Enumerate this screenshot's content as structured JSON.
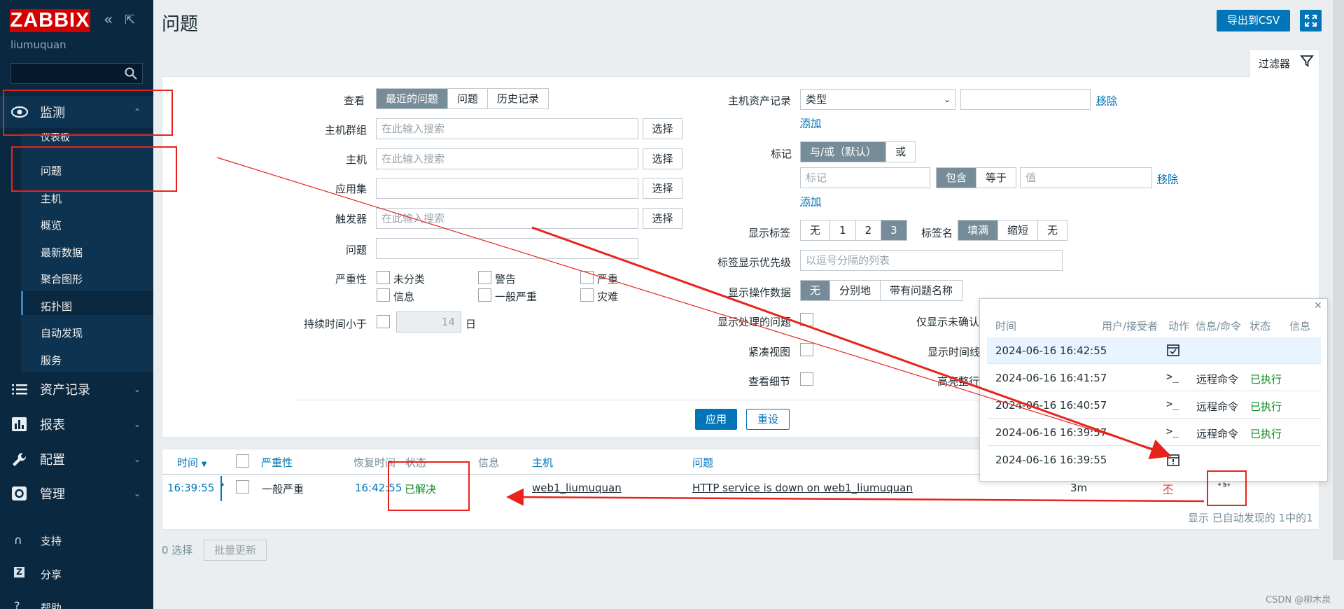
{
  "sidebar": {
    "logo": "ZABBIX",
    "username": "liumuquan",
    "search_placeholder": "",
    "sections": [
      {
        "label": "监测",
        "icon": "eye-icon"
      },
      {
        "label": "资产记录",
        "icon": "list-icon"
      },
      {
        "label": "报表",
        "icon": "bar-chart-icon"
      },
      {
        "label": "配置",
        "icon": "wrench-icon"
      },
      {
        "label": "管理",
        "icon": "gear-icon"
      }
    ],
    "monitoring_items": [
      "仪表板",
      "问题",
      "主机",
      "概览",
      "最新数据",
      "聚合图形",
      "拓扑图",
      "自动发现",
      "服务"
    ],
    "bottom": [
      {
        "label": "支持",
        "icon": "headset-icon"
      },
      {
        "label": "分享",
        "icon": "share-icon"
      },
      {
        "label": "帮助",
        "icon": "help-icon"
      }
    ]
  },
  "header": {
    "title": "问题",
    "export_label": "导出到CSV"
  },
  "filter": {
    "tab_label": "过滤器",
    "show_label": "查看",
    "show_options": [
      "最近的问题",
      "问题",
      "历史记录"
    ],
    "hostgroup_label": "主机群组",
    "host_label": "主机",
    "app_label": "应用集",
    "trigger_label": "触发器",
    "problem_label": "问题",
    "search_placeholder": "在此输入搜索",
    "select_label": "选择",
    "severity_label": "严重性",
    "severities": [
      "未分类",
      "警告",
      "严重",
      "信息",
      "一般严重",
      "灾难"
    ],
    "duration_label": "持续时间小于",
    "duration_value": "14",
    "duration_unit": "日",
    "inventory_label": "主机资产记录",
    "inventory_type": "类型",
    "remove_label": "移除",
    "add_label": "添加",
    "tags_label": "标记",
    "tags_eval_options": [
      "与/或（默认）",
      "或"
    ],
    "tag_placeholder": "标记",
    "tag_ops": [
      "包含",
      "等于"
    ],
    "value_placeholder": "值",
    "show_tags_label": "显示标签",
    "show_tags_options": [
      "无",
      "1",
      "2",
      "3"
    ],
    "tag_name_label": "标签名",
    "tag_name_options": [
      "填满",
      "缩短",
      "无"
    ],
    "tag_priority_label": "标签显示优先级",
    "tag_priority_placeholder": "以逗号分隔的列表",
    "op_data_label": "显示操作数据",
    "op_data_options": [
      "无",
      "分别地",
      "带有问题名称"
    ],
    "suppressed_label": "显示处理的问题",
    "unack_label": "仅显示未确认",
    "compact_label": "紧凑视图",
    "timeline_label": "显示时间线",
    "details_label": "查看细节",
    "highlight_label": "高亮整行",
    "apply_label": "应用",
    "reset_label": "重设"
  },
  "table": {
    "headers": [
      "时间",
      "严重性",
      "恢复时间",
      "状态",
      "信息",
      "主机",
      "问题"
    ],
    "row": {
      "time": "16:39:55",
      "severity": "一般严重",
      "recovery": "16:42:55",
      "status": "已解决",
      "host": "web1_liumuquan",
      "problem": "HTTP service is down on web1_liumuquan",
      "duration": "3m",
      "ack": "不",
      "actions_count": "3"
    },
    "footer": "显示 已自动发现的 1中的1",
    "selected": "0 选择",
    "mass_update": "批量更新"
  },
  "popup": {
    "headers": [
      "时间",
      "用户/接受者",
      "动作",
      "信息/命令",
      "状态",
      "信息"
    ],
    "rows": [
      {
        "time": "2024-06-16 16:42:55",
        "command": "",
        "status": ""
      },
      {
        "time": "2024-06-16 16:41:57",
        "command": "远程命令",
        "status": "已执行"
      },
      {
        "time": "2024-06-16 16:40:57",
        "command": "远程命令",
        "status": "已执行"
      },
      {
        "time": "2024-06-16 16:39:57",
        "command": "远程命令",
        "status": "已执行"
      },
      {
        "time": "2024-06-16 16:39:55",
        "command": "",
        "status": ""
      }
    ]
  },
  "watermark": "CSDN @柳木泉",
  "colors": {
    "brand_red": "#d40000",
    "accent_blue": "#0275b8",
    "sidebar": "#0b2841",
    "resolved_green": "#0b8a20",
    "annotation_red": "#e8231c"
  }
}
